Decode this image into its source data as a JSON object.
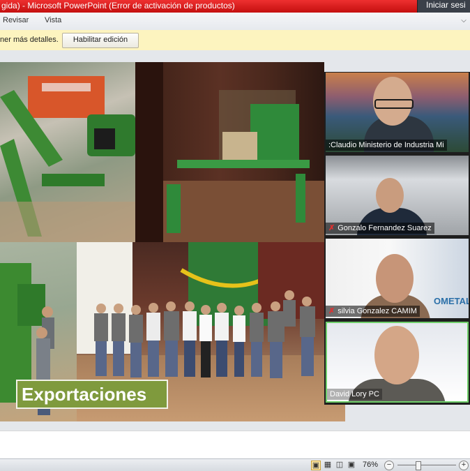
{
  "window": {
    "title": "gida) - Microsoft PowerPoint (Error de activación de productos)",
    "sign_in": "Iniciar sesi"
  },
  "ribbon": {
    "tabs": [
      "Revisar",
      "Vista"
    ]
  },
  "message_bar": {
    "text": "ner más detalles.",
    "button": "Habilitar edición"
  },
  "slide": {
    "caption": "Exportaciones",
    "caption_color": "#7f9a3d"
  },
  "video_call": {
    "participants": [
      {
        "name": ":Claudio Ministerio de Industria Mi",
        "muted": false
      },
      {
        "name": "Gonzalo Fernandez Suarez",
        "muted": true
      },
      {
        "name": "silvia Gonzalez CAMIM",
        "muted": true
      },
      {
        "name": "David Lory PC",
        "muted": false,
        "active_speaker": true
      }
    ],
    "background_logo_text": "OMETAL",
    "active_speaker_border": "#6fcf6a",
    "muted_icon_color": "#e23030"
  },
  "status_bar": {
    "zoom": "76%"
  },
  "colors": {
    "title_bar": "#c40f0f",
    "message_bar": "#fdf4bf"
  }
}
